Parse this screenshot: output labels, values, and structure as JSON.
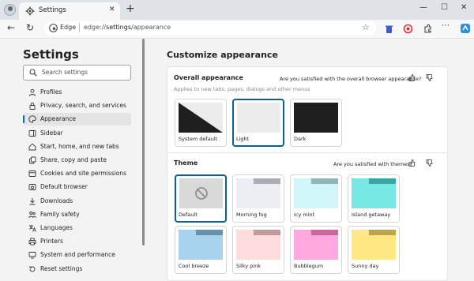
{
  "browser": {
    "tab_title": "Settings",
    "new_tab": "+",
    "controls": {
      "minimize": "—",
      "maximize": "☐",
      "close": "✕"
    },
    "address_label": "Edge",
    "url_scheme": "edge://",
    "url_host": "settings",
    "url_path": "/appearance"
  },
  "sidebar": {
    "title": "Settings",
    "search_placeholder": "Search settings",
    "items": [
      {
        "label": "Profiles",
        "icon": "profile-icon"
      },
      {
        "label": "Privacy, search, and services",
        "icon": "lock-icon"
      },
      {
        "label": "Appearance",
        "icon": "palette-icon",
        "active": true
      },
      {
        "label": "Sidebar",
        "icon": "sidebar-icon"
      },
      {
        "label": "Start, home, and new tabs",
        "icon": "home-icon"
      },
      {
        "label": "Share, copy and paste",
        "icon": "share-icon"
      },
      {
        "label": "Cookies and site permissions",
        "icon": "cookie-icon"
      },
      {
        "label": "Default browser",
        "icon": "browser-icon"
      },
      {
        "label": "Downloads",
        "icon": "download-icon"
      },
      {
        "label": "Family safety",
        "icon": "family-icon"
      },
      {
        "label": "Languages",
        "icon": "language-icon"
      },
      {
        "label": "Printers",
        "icon": "printer-icon"
      },
      {
        "label": "System and performance",
        "icon": "system-icon"
      },
      {
        "label": "Reset settings",
        "icon": "reset-icon"
      }
    ]
  },
  "main": {
    "title": "Customize appearance",
    "overall": {
      "title": "Overall appearance",
      "subtitle": "Applies to new tabs, pages, dialogs and other menus",
      "feedback": "Are you satisfied with the overall browser appearance?",
      "options": [
        {
          "label": "System default",
          "selected": false
        },
        {
          "label": "Light",
          "selected": true
        },
        {
          "label": "Dark",
          "selected": false
        }
      ]
    },
    "theme": {
      "title": "Theme",
      "feedback": "Are you satisfied with themes?",
      "options": [
        {
          "label": "Default",
          "selected": true,
          "color": "#d9d9d9"
        },
        {
          "label": "Morning fog",
          "selected": false,
          "color": "#d2d6db"
        },
        {
          "label": "Icy mint",
          "selected": false,
          "color": "#b8dde0"
        },
        {
          "label": "Island getaway",
          "selected": false,
          "color": "#5fcfcb"
        },
        {
          "label": "Cool breeze",
          "selected": false,
          "color": "#8fbad6"
        },
        {
          "label": "Silky pink",
          "selected": false,
          "color": "#e8c3c3"
        },
        {
          "label": "Bubblegum",
          "selected": false,
          "color": "#f48fc6"
        },
        {
          "label": "Sunny day",
          "selected": false,
          "color": "#e6cf6a"
        }
      ]
    }
  },
  "colors": {
    "accent": "#0a65c9",
    "selected_border": "#0f5f8a"
  }
}
